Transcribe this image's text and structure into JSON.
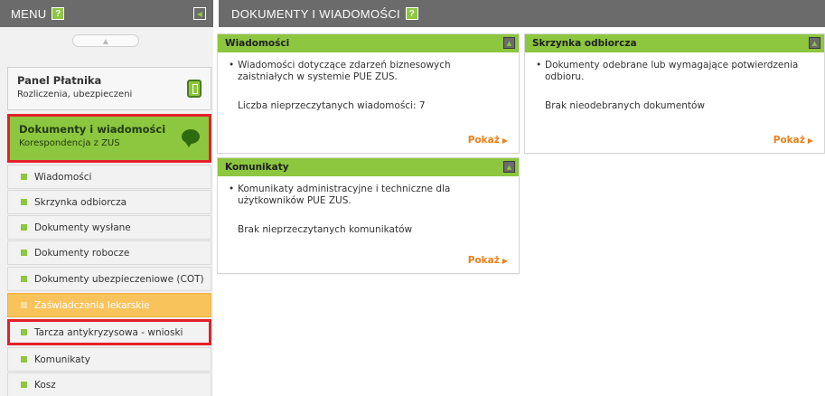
{
  "sidebar": {
    "header": {
      "title": "MENU",
      "help": "?"
    },
    "panels": [
      {
        "title": "Panel Płatnika",
        "subtitle": "Rozliczenia, ubezpieczeni"
      },
      {
        "title": "Dokumenty i wiadomości",
        "subtitle": "Korespondencja z ZUS"
      }
    ],
    "items": [
      {
        "label": "Wiadomości"
      },
      {
        "label": "Skrzynka odbiorcza"
      },
      {
        "label": "Dokumenty wysłane"
      },
      {
        "label": "Dokumenty robocze"
      },
      {
        "label": "Dokumenty ubezpieczeniowe (COT)"
      },
      {
        "label": "Zaświadczenia lekarskie",
        "active": true
      },
      {
        "label": "Tarcza antykryzysowa - wnioski",
        "highlighted": true
      },
      {
        "label": "Komunikaty"
      },
      {
        "label": "Kosz"
      }
    ]
  },
  "main": {
    "header": {
      "title": "DOKUMENTY I WIADOMOŚCI",
      "help": "?"
    },
    "cards": [
      {
        "title": "Wiadomości",
        "bullet": "Wiadomości dotyczące zdarzeń biznesowych zaistniałych w systemie PUE ZUS.",
        "info": "Liczba nieprzeczytanych wiadomości: 7",
        "link": "Pokaż"
      },
      {
        "title": "Skrzynka odbiorcza",
        "bullet": "Dokumenty odebrane lub wymagające potwierdzenia odbioru.",
        "info": "Brak nieodebranych dokumentów",
        "link": "Pokaż"
      },
      {
        "title": "Komunikaty",
        "bullet": "Komunikaty administracyjne i techniczne dla użytkowników PUE ZUS.",
        "info": "Brak nieprzeczytanych komunikatów",
        "link": "Pokaż"
      }
    ]
  },
  "colors": {
    "accent_green": "#8dc63f",
    "header_gray": "#6b6b6b",
    "highlight_red": "#e4202a",
    "active_orange": "#f9c35c",
    "link_orange": "#f07e1b"
  }
}
